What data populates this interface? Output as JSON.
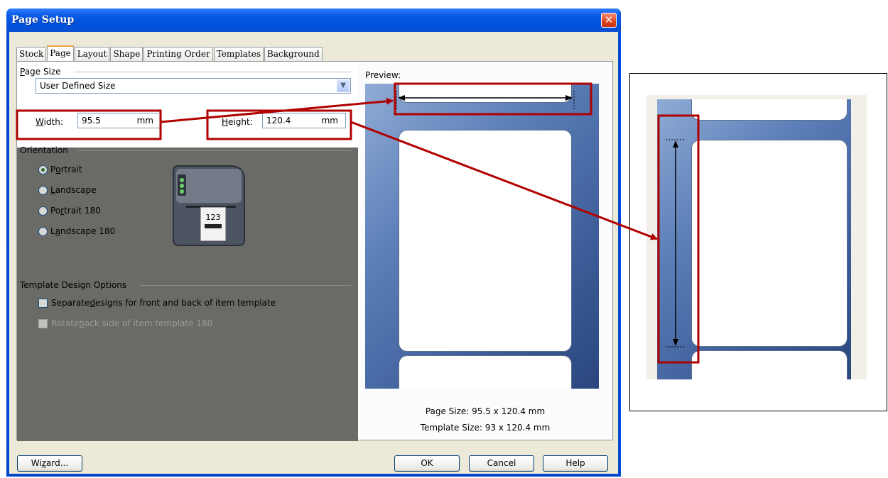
{
  "dialog": {
    "title": "Page Setup",
    "close_glyph": "✕",
    "tabs": [
      "Stock",
      "Page",
      "Layout",
      "Shape",
      "Printing Order",
      "Templates",
      "Background"
    ],
    "active_tab": "Page"
  },
  "page_size": {
    "group_label_pre": "",
    "group_label_u": "P",
    "group_label_post": "age Size",
    "selected": "User Defined Size",
    "width_label_u": "W",
    "width_label_post": "idth:",
    "width_value": "95.5",
    "width_unit": "mm",
    "height_label_u": "H",
    "height_label_post": "eight:",
    "height_value": "120.4",
    "height_unit": "mm"
  },
  "orientation": {
    "group_label": "Orientation",
    "options": [
      {
        "pre": "P",
        "u": "o",
        "post": "rtrait",
        "checked": true
      },
      {
        "pre": "",
        "u": "L",
        "post": "andscape",
        "checked": false
      },
      {
        "pre": "Po",
        "u": "r",
        "post": "trait 180",
        "checked": false
      },
      {
        "pre": "L",
        "u": "a",
        "post": "ndscape 180",
        "checked": false
      }
    ],
    "printer_label_text": "123"
  },
  "template_options": {
    "group_label": "Template Design Options",
    "separate_pre": "Separate ",
    "separate_u": "d",
    "separate_post": "esigns for front and back of item template",
    "rotate_pre": "Rotate ",
    "rotate_u": "b",
    "rotate_post": "ack side of item template 180"
  },
  "preview": {
    "label": "Preview:",
    "page_size_text": "Page Size:  95.5 x 120.4 mm",
    "template_size_text": "Template Size:  93 x 120.4 mm"
  },
  "buttons": {
    "wizard_pre": "Wi",
    "wizard_u": "z",
    "wizard_post": "ard...",
    "ok": "OK",
    "cancel": "Cancel",
    "help": "Help"
  },
  "colors": {
    "highlight_red": "#b00000",
    "title_blue": "#0a5ae5",
    "preview_blue": "#3a5a95"
  }
}
